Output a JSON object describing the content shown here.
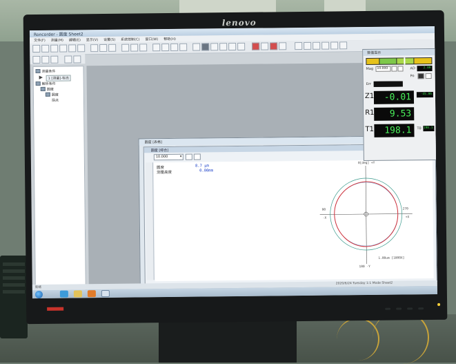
{
  "monitor": {
    "brand": "lenovo"
  },
  "window": {
    "title": "Roncorder - 圆度 Sheet2"
  },
  "menu": [
    "文件(F)",
    "测量(M)",
    "编辑(E)",
    "显示(V)",
    "设置(S)",
    "系统控制(C)",
    "窗口(W)",
    "帮助(H)"
  ],
  "tree": {
    "root": "测量条件",
    "level1": "1 [测量]-标志",
    "level2": "解析条件",
    "level3": "圆度",
    "item_a": "圆度",
    "item_b": "拐点"
  },
  "measurement_window": {
    "outer_title": "圆度 [表格]",
    "inner_title": "圆度 [综合]",
    "scale_value": "10.000",
    "rows": [
      {
        "label": "圆度",
        "value": "8.7 μm"
      },
      {
        "label": "测量高度",
        "value": "0.00mm"
      }
    ]
  },
  "polar_plot": {
    "top_label": "0[deg] +Y",
    "left_label": "90",
    "left_sign": "-X",
    "right_label": "270",
    "right_sign": "+X",
    "bottom_label": "180 -Y",
    "scale_note": "1.00um [1000X]"
  },
  "readout": {
    "title": "数值显示",
    "mag_label": "Mag",
    "mag_value": "10.000",
    "ad_label": "AD",
    "ad_value": "2.00",
    "po_label": "Po",
    "err_label": "Err",
    "z1_label": "Z1",
    "z1_value": "-0.01",
    "z1_side": "-45.86",
    "r1_label": "R1",
    "r1_value": "9.53",
    "t1_label": "T1",
    "t1_value": "198.1",
    "t1_side": "198.1",
    "meter_fill": 0.58
  },
  "status": {
    "left": "就绪",
    "right": "2020/6/24 Tuesday  1:1  Mode  Sheet2"
  },
  "colors": {
    "screen_bg": "#cdd3d8",
    "readout_green": "#49f25a",
    "trace_red": "#d0303a",
    "reference_circle": "#3a9a8c"
  }
}
